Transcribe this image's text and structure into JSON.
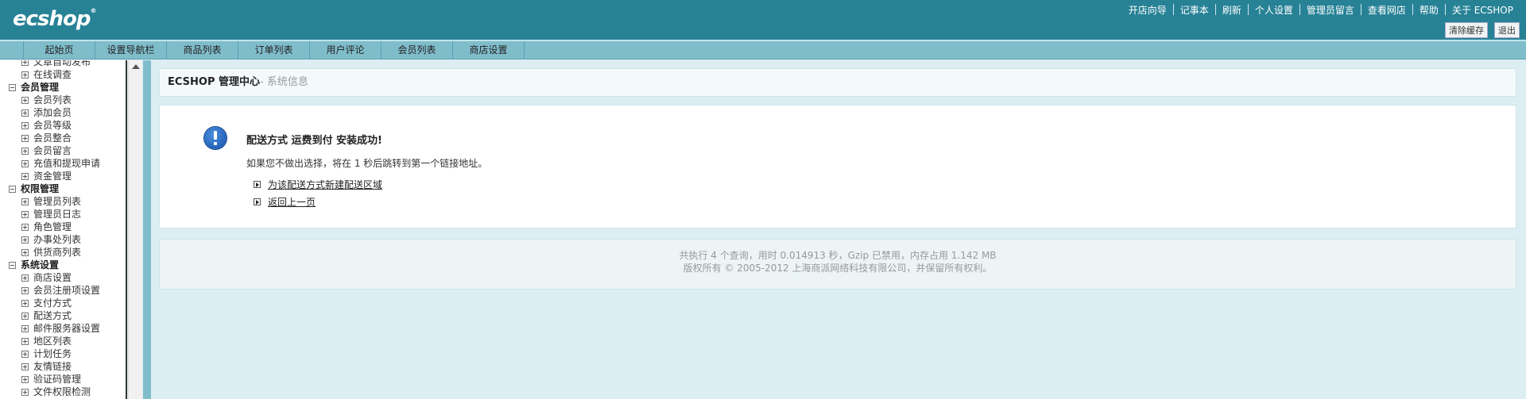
{
  "header": {
    "logo": "ecshop",
    "top_links": [
      "开店向导",
      "记事本",
      "刷新",
      "个人设置",
      "管理员留言",
      "查看网店",
      "帮助",
      "关于 ECSHOP"
    ],
    "buttons": [
      "清除缓存",
      "退出"
    ]
  },
  "nav": {
    "tabs": [
      "起始页",
      "设置导航栏",
      "商品列表",
      "订单列表",
      "用户评论",
      "会员列表",
      "商店设置"
    ]
  },
  "menu": {
    "items": [
      {
        "type": "item",
        "label": "文章自动发布"
      },
      {
        "type": "item",
        "label": "在线调查"
      },
      {
        "type": "group",
        "label": "会员管理"
      },
      {
        "type": "item",
        "label": "会员列表"
      },
      {
        "type": "item",
        "label": "添加会员"
      },
      {
        "type": "item",
        "label": "会员等级"
      },
      {
        "type": "item",
        "label": "会员整合"
      },
      {
        "type": "item",
        "label": "会员留言"
      },
      {
        "type": "item",
        "label": "充值和提现申请"
      },
      {
        "type": "item",
        "label": "资金管理"
      },
      {
        "type": "group",
        "label": "权限管理"
      },
      {
        "type": "item",
        "label": "管理员列表"
      },
      {
        "type": "item",
        "label": "管理员日志"
      },
      {
        "type": "item",
        "label": "角色管理"
      },
      {
        "type": "item",
        "label": "办事处列表"
      },
      {
        "type": "item",
        "label": "供货商列表"
      },
      {
        "type": "group",
        "label": "系统设置"
      },
      {
        "type": "item",
        "label": "商店设置"
      },
      {
        "type": "item",
        "label": "会员注册项设置"
      },
      {
        "type": "item",
        "label": "支付方式"
      },
      {
        "type": "item",
        "label": "配送方式"
      },
      {
        "type": "item",
        "label": "邮件服务器设置"
      },
      {
        "type": "item",
        "label": "地区列表"
      },
      {
        "type": "item",
        "label": "计划任务"
      },
      {
        "type": "item",
        "label": "友情链接"
      },
      {
        "type": "item",
        "label": "验证码管理"
      },
      {
        "type": "item",
        "label": "文件权限检测"
      }
    ]
  },
  "main": {
    "title": "ECSHOP 管理中心",
    "subtitle": "- 系统信息",
    "message_title": "配送方式 运费到付 安装成功!",
    "message_text": "如果您不做出选择，将在 1 秒后跳转到第一个链接地址。",
    "links": [
      "为该配送方式新建配送区域",
      "返回上一页"
    ]
  },
  "footer": {
    "line1": "共执行 4 个查询，用时 0.014913 秒，Gzip 已禁用，内存占用 1.142 MB",
    "line2": "版权所有 © 2005-2012 上海商派网络科技有限公司，并保留所有权利。"
  },
  "colors": {
    "header_bg": "#278296",
    "nav_bg": "#80bdcb",
    "page_bg": "#ddeef2"
  }
}
